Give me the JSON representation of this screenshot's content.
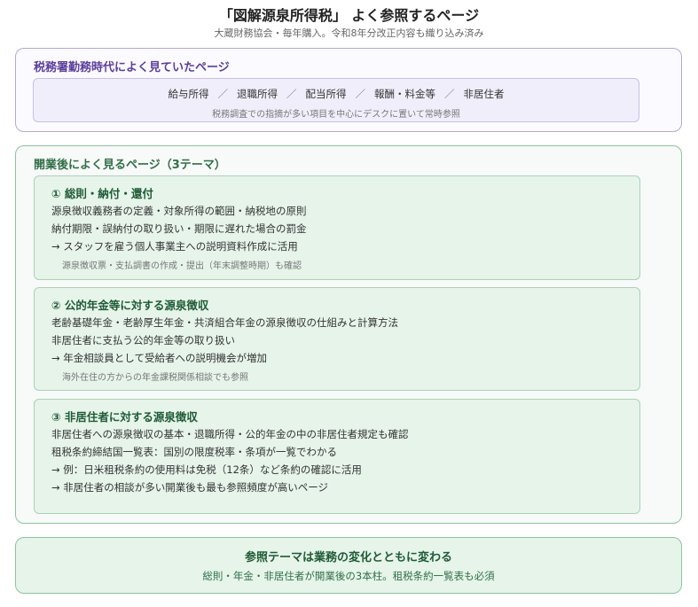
{
  "header": {
    "title": "「図解源泉所得税」 よく参照するページ",
    "subtitle": "大蔵財務協会・毎年購入。令和8年分改正内容も織り込み済み"
  },
  "tax_office": {
    "heading": "税務署勤務時代によく見ていたページ",
    "items": [
      "給与所得",
      "退職所得",
      "配当所得",
      "報酬・料金等",
      "非居住者"
    ],
    "separator": "／",
    "note": "税務調査での指摘が多い項目を中心にデスクに置いて常時参照"
  },
  "after_opening": {
    "heading": "開業後によく見るページ（3テーマ）",
    "themes": [
      {
        "title": "① 総則・納付・還付",
        "lines": [
          "源泉徴収義務者の定義・対象所得の範囲・納税地の原則",
          "納付期限・誤納付の取り扱い・期限に遅れた場合の罰金",
          "→ スタッフを雇う個人事業主への説明資料作成に活用"
        ],
        "note": "源泉徴収票・支払調書の作成・提出（年末調整時期）も確認"
      },
      {
        "title": "② 公的年金等に対する源泉徴収",
        "lines": [
          "老齢基礎年金・老齢厚生年金・共済組合年金の源泉徴収の仕組みと計算方法",
          "非居住者に支払う公的年金等の取り扱い",
          "→ 年金相談員として受給者への説明機会が増加"
        ],
        "note": "海外在住の方からの年金課税関係相談でも参照"
      },
      {
        "title": "③ 非居住者に対する源泉徴収",
        "lines": [
          "非居住者への源泉徴収の基本・退職所得・公的年金の中の非居住者規定も確認",
          "租税条約締結国一覧表：国別の限度税率・条項が一覧でわかる",
          "→ 例：日米租税条約の使用料は免税（12条）など条約の確認に活用",
          "→ 非居住者の相談が多い開業後も最も参照頻度が高いページ"
        ]
      }
    ]
  },
  "summary": {
    "title": "参照テーマは業務の変化とともに変わる",
    "text": "総則・年金・非居住者が開業後の3本柱。租税条約一覧表も必須"
  }
}
